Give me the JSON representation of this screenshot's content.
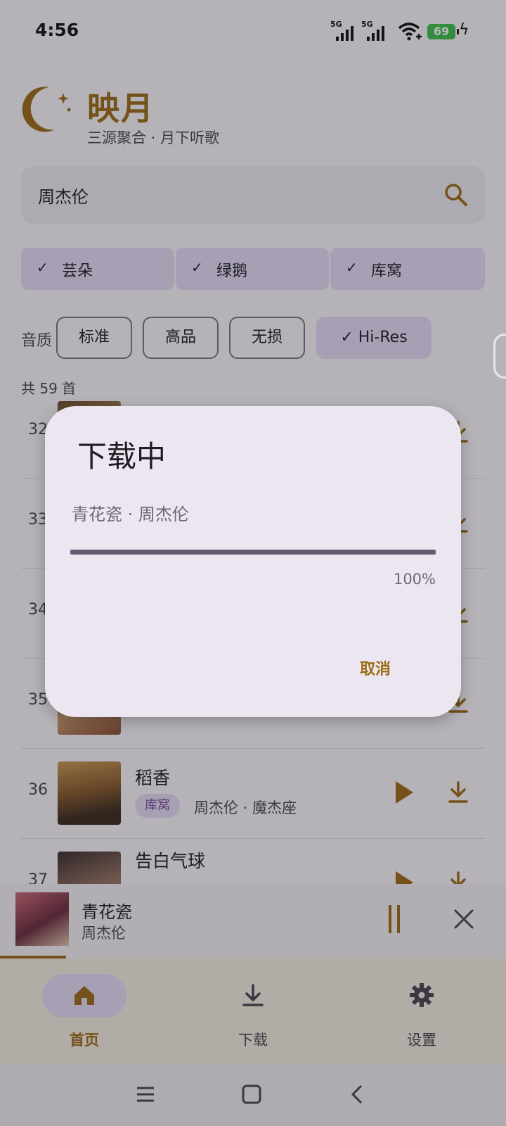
{
  "status_bar": {
    "time": "4:56",
    "signal1": "5G",
    "signal2": "5G",
    "battery": "69"
  },
  "header": {
    "title": "映月",
    "subtitle": "三源聚合 · 月下听歌"
  },
  "search": {
    "value": "周杰伦"
  },
  "sources": [
    {
      "label": "芸朵",
      "selected": true
    },
    {
      "label": "绿鹅",
      "selected": true
    },
    {
      "label": "库窝",
      "selected": true
    }
  ],
  "quality": {
    "label": "音质",
    "options": [
      {
        "label": "标准",
        "selected": false
      },
      {
        "label": "高品",
        "selected": false
      },
      {
        "label": "无损",
        "selected": false
      },
      {
        "label": "Hi-Res",
        "selected": true
      }
    ]
  },
  "results": {
    "count_text": "共 59 首",
    "rows": [
      {
        "num": "32",
        "title": "",
        "badge": "",
        "meta": ""
      },
      {
        "num": "33",
        "title": "",
        "badge": "",
        "meta": ""
      },
      {
        "num": "34",
        "title": "",
        "badge": "",
        "meta": ""
      },
      {
        "num": "35",
        "title": "",
        "badge": "",
        "meta": ""
      },
      {
        "num": "36",
        "title": "稻香",
        "badge": "库窝",
        "meta": "周杰伦 · 魔杰座"
      },
      {
        "num": "37",
        "title": "告白气球",
        "badge": "",
        "meta": ""
      }
    ]
  },
  "now_playing": {
    "title": "青花瓷",
    "artist": "周杰伦",
    "progress": 0.13
  },
  "nav": [
    {
      "label": "首页",
      "icon": "home-icon",
      "active": true
    },
    {
      "label": "下载",
      "icon": "download-icon",
      "active": false
    },
    {
      "label": "设置",
      "icon": "gear-icon",
      "active": false
    }
  ],
  "dialog": {
    "title": "下载中",
    "song": "青花瓷 · 周杰伦",
    "progress": 1.0,
    "percent_text": "100%",
    "cancel_label": "取消"
  },
  "colors": {
    "accent": "#9c6b13",
    "chip": "#e8def8",
    "progress": "#625b71"
  }
}
